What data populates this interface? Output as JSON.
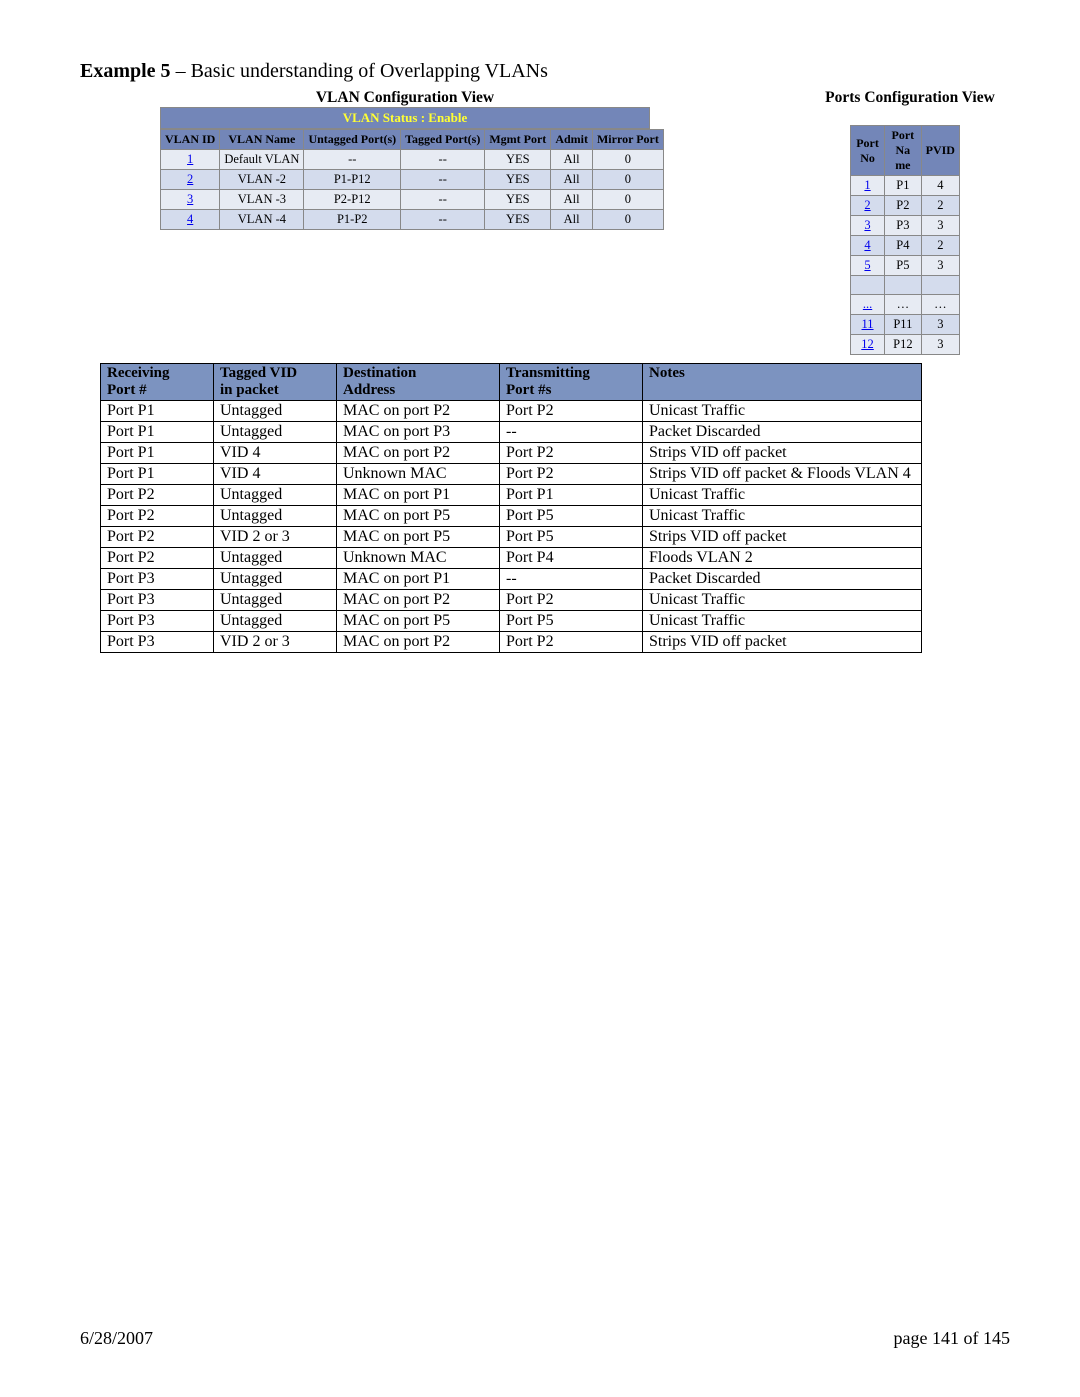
{
  "title": {
    "strong": "Example 5",
    "rest": " – Basic understanding of Overlapping VLANs"
  },
  "vlan_view_label": "VLAN Configuration View",
  "ports_view_label": "Ports Configuration View",
  "vlan_status_label": "VLAN Status   :   Enable",
  "vlan_headers": [
    "VLAN ID",
    "VLAN Name",
    "Untagged Port(s)",
    "Tagged Port(s)",
    "Mgmt Port",
    "Admit",
    "Mirror Port"
  ],
  "vlan_rows": [
    {
      "id": "1",
      "name": "Default VLAN",
      "untag": "--",
      "tag": "--",
      "mgmt": "YES",
      "admit": "All",
      "mirror": "0"
    },
    {
      "id": "2",
      "name": "VLAN -2",
      "untag": "P1-P12",
      "tag": "--",
      "mgmt": "YES",
      "admit": "All",
      "mirror": "0"
    },
    {
      "id": "3",
      "name": "VLAN -3",
      "untag": "P2-P12",
      "tag": "--",
      "mgmt": "YES",
      "admit": "All",
      "mirror": "0"
    },
    {
      "id": "4",
      "name": "VLAN -4",
      "untag": "P1-P2",
      "tag": "--",
      "mgmt": "YES",
      "admit": "All",
      "mirror": "0"
    }
  ],
  "ports_headers": [
    "Port No",
    "Port Na me",
    "PVID"
  ],
  "ports_rows": [
    {
      "no": "1",
      "name": "P1",
      "pvid": "4"
    },
    {
      "no": "2",
      "name": "P2",
      "pvid": "2"
    },
    {
      "no": "3",
      "name": "P3",
      "pvid": "3"
    },
    {
      "no": "4",
      "name": "P4",
      "pvid": "2"
    },
    {
      "no": "5",
      "name": "P5",
      "pvid": "3"
    },
    {
      "no": "",
      "name": "",
      "pvid": ""
    },
    {
      "no": "...",
      "name": "…",
      "pvid": "…"
    },
    {
      "no": "11",
      "name": "P11",
      "pvid": "3"
    },
    {
      "no": "12",
      "name": "P12",
      "pvid": "3"
    }
  ],
  "traffic_headers": {
    "a1": "Receiving",
    "a2": "Port #",
    "b1": "Tagged VID",
    "b2": "in packet",
    "c1": "Destination",
    "c2": "Address",
    "d1": "Transmitting",
    "d2": "Port #s",
    "e": "Notes"
  },
  "traffic_rows": [
    {
      "a": "Port P1",
      "b": "Untagged",
      "c": "MAC on port P2",
      "d": "Port P2",
      "e": "Unicast Traffic"
    },
    {
      "a": "Port P1",
      "b": "Untagged",
      "c": "MAC on port P3",
      "d": "--",
      "e": "Packet Discarded"
    },
    {
      "a": "Port P1",
      "b": "VID 4",
      "c": "MAC on port P2",
      "d": "Port P2",
      "e": "Strips VID off packet"
    },
    {
      "a": "Port P1",
      "b": "VID 4",
      "c": "Unknown MAC",
      "d": "Port P2",
      "e": "Strips VID off packet & Floods VLAN 4"
    },
    {
      "a": "Port P2",
      "b": "Untagged",
      "c": "MAC on port P1",
      "d": "Port P1",
      "e": "Unicast Traffic"
    },
    {
      "a": "Port P2",
      "b": "Untagged",
      "c": "MAC on port P5",
      "d": "Port P5",
      "e": "Unicast Traffic"
    },
    {
      "a": "Port P2",
      "b": "VID 2 or 3",
      "c": "MAC on port P5",
      "d": "Port P5",
      "e": "Strips VID off packet"
    },
    {
      "a": "Port P2",
      "b": "Untagged",
      "c": "Unknown MAC",
      "d": "Port P4",
      "e": "Floods VLAN 2"
    },
    {
      "a": "Port P3",
      "b": "Untagged",
      "c": "MAC on port P1",
      "d": "--",
      "e": "Packet Discarded"
    },
    {
      "a": "Port P3",
      "b": "Untagged",
      "c": "MAC on port P2",
      "d": "Port P2",
      "e": "Unicast Traffic"
    },
    {
      "a": "Port P3",
      "b": "Untagged",
      "c": "MAC on port P5",
      "d": "Port P5",
      "e": "Unicast Traffic"
    },
    {
      "a": "Port P3",
      "b": "VID 2 or 3",
      "c": "MAC on port P2",
      "d": "Port P2",
      "e": "Strips VID off packet"
    }
  ],
  "footer": {
    "date": "6/28/2007",
    "page": "page 141 of 145"
  }
}
